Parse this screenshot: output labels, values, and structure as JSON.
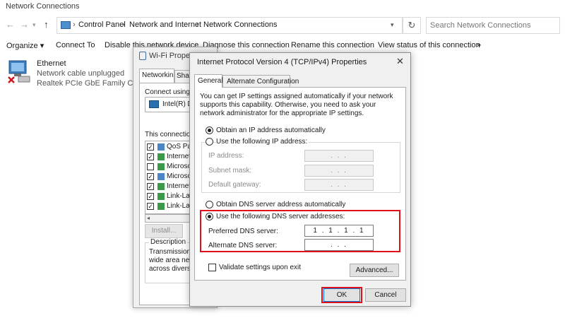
{
  "explorer": {
    "title": "Network Connections",
    "breadcrumb": [
      "Control Panel",
      "Network and Internet",
      "Network Connections"
    ],
    "search_placeholder": "Search Network Connections",
    "commands": [
      "Organize ▾",
      "Connect To",
      "Disable this network device",
      "Diagnose this connection",
      "Rename this connection",
      "View status of this connection",
      "»"
    ],
    "adapter": {
      "name": "Ethernet",
      "status": "Network cable unplugged",
      "device": "Realtek PCIe GbE Family Controll"
    }
  },
  "wifi_props": {
    "title": "Wi-Fi Propert",
    "tabs": [
      "Networking",
      "Shar"
    ],
    "connect_using_label": "Connect using:",
    "adapter_name": "Intel(R) Du",
    "connection_uses_label": "This connection u",
    "items": [
      {
        "label": "QoS Pa",
        "checked": true
      },
      {
        "label": "Internet",
        "checked": true
      },
      {
        "label": "Microso",
        "checked": false
      },
      {
        "label": "Microso",
        "checked": true
      },
      {
        "label": "Internet",
        "checked": true
      },
      {
        "label": "Link-Lay",
        "checked": true
      },
      {
        "label": "Link-Lay",
        "checked": true
      }
    ],
    "install_label": "Install...",
    "description_label": "Description",
    "description_lines": [
      "Transmission C",
      "wide area net",
      "across diverse"
    ]
  },
  "ipv4": {
    "title": "Internet Protocol Version 4 (TCP/IPv4) Properties",
    "close_glyph": "✕",
    "tabs": [
      "General",
      "Alternate Configuration"
    ],
    "intro": "You can get IP settings assigned automatically if your network supports this capability. Otherwise, you need to ask your network administrator for the appropriate IP settings.",
    "ip_auto_label": "Obtain an IP address automatically",
    "ip_manual_label": "Use the following IP address:",
    "ip_auto_selected": true,
    "fields": {
      "ip_label": "IP address:",
      "subnet_label": "Subnet mask:",
      "gateway_label": "Default gateway:",
      "empty_ip": ". . ."
    },
    "dns_auto_label": "Obtain DNS server address automatically",
    "dns_manual_label": "Use the following DNS server addresses:",
    "dns_manual_selected": true,
    "preferred_dns_label": "Preferred DNS server:",
    "preferred_dns_value": "1 . 1 . 1 . 1",
    "alternate_dns_label": "Alternate DNS server:",
    "alternate_dns_value": ". . .",
    "validate_label": "Validate settings upon exit",
    "validate_checked": false,
    "advanced_label": "Advanced...",
    "ok_label": "OK",
    "cancel_label": "Cancel"
  },
  "colors": {
    "highlight": "#e0101b",
    "accent": "#0078d7",
    "dialog_bg": "#f0f0f0"
  }
}
